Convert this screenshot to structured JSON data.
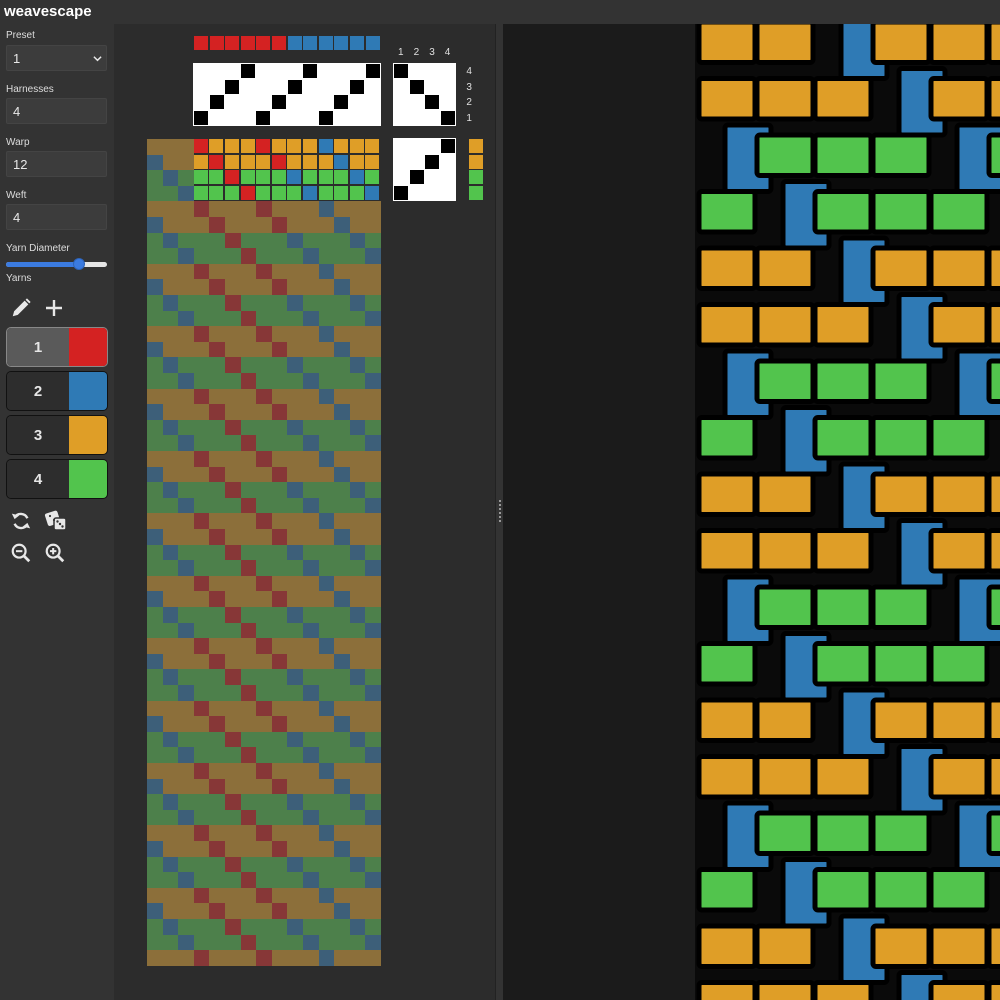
{
  "app": {
    "title": "weavescape"
  },
  "sidebar": {
    "preset": {
      "label": "Preset",
      "value": "1"
    },
    "harnesses": {
      "label": "Harnesses",
      "value": "4"
    },
    "warp": {
      "label": "Warp",
      "value": "12"
    },
    "weft": {
      "label": "Weft",
      "value": "4"
    },
    "yarn_diameter": {
      "label": "Yarn Diameter",
      "value_fraction": 0.72
    },
    "yarns": {
      "label": "Yarns",
      "toolbar_icons": [
        "pencil-icon",
        "plus-icon"
      ],
      "items": [
        {
          "label": "1",
          "color": "#d42222",
          "selected": true
        },
        {
          "label": "2",
          "color": "#2f7ab5",
          "selected": false
        },
        {
          "label": "3",
          "color": "#df9e27",
          "selected": false
        },
        {
          "label": "4",
          "color": "#52c44d",
          "selected": false
        }
      ]
    },
    "action_icons": [
      "refresh-icon",
      "dice-icon",
      "zoom-out-icon",
      "zoom-in-icon"
    ]
  },
  "draft": {
    "warp_colors": [
      1,
      1,
      1,
      1,
      1,
      1,
      2,
      2,
      2,
      2,
      2,
      2
    ],
    "threading": [
      1,
      2,
      3,
      4,
      1,
      2,
      3,
      4,
      1,
      2,
      3,
      4
    ],
    "tieup": [
      [
        1,
        0,
        0,
        0
      ],
      [
        0,
        1,
        0,
        0
      ],
      [
        0,
        0,
        1,
        0
      ],
      [
        0,
        0,
        0,
        1
      ]
    ],
    "treadling": [
      4,
      3,
      2,
      1
    ],
    "weft_colors": [
      3,
      3,
      4,
      4
    ],
    "tieup_numbers": [
      "1",
      "2",
      "3",
      "4"
    ],
    "harness_numbers": [
      "4",
      "3",
      "2",
      "1"
    ],
    "drawdown_repeats": 5
  },
  "colors": {
    "bg": "#333333",
    "panel": "#2c2c2c",
    "preview_bg": "#1b1b1b",
    "accent": "#3b7be0"
  }
}
